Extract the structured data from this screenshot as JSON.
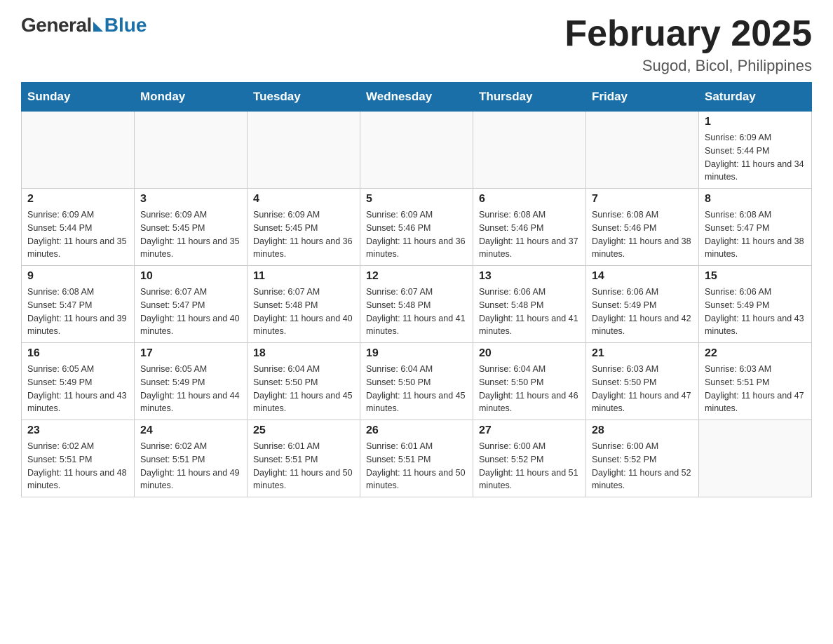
{
  "logo": {
    "general": "General",
    "blue": "Blue"
  },
  "header": {
    "month_year": "February 2025",
    "location": "Sugod, Bicol, Philippines"
  },
  "days_of_week": [
    "Sunday",
    "Monday",
    "Tuesday",
    "Wednesday",
    "Thursday",
    "Friday",
    "Saturday"
  ],
  "weeks": [
    [
      null,
      null,
      null,
      null,
      null,
      null,
      {
        "day": "1",
        "sunrise": "Sunrise: 6:09 AM",
        "sunset": "Sunset: 5:44 PM",
        "daylight": "Daylight: 11 hours and 34 minutes."
      }
    ],
    [
      {
        "day": "2",
        "sunrise": "Sunrise: 6:09 AM",
        "sunset": "Sunset: 5:44 PM",
        "daylight": "Daylight: 11 hours and 35 minutes."
      },
      {
        "day": "3",
        "sunrise": "Sunrise: 6:09 AM",
        "sunset": "Sunset: 5:45 PM",
        "daylight": "Daylight: 11 hours and 35 minutes."
      },
      {
        "day": "4",
        "sunrise": "Sunrise: 6:09 AM",
        "sunset": "Sunset: 5:45 PM",
        "daylight": "Daylight: 11 hours and 36 minutes."
      },
      {
        "day": "5",
        "sunrise": "Sunrise: 6:09 AM",
        "sunset": "Sunset: 5:46 PM",
        "daylight": "Daylight: 11 hours and 36 minutes."
      },
      {
        "day": "6",
        "sunrise": "Sunrise: 6:08 AM",
        "sunset": "Sunset: 5:46 PM",
        "daylight": "Daylight: 11 hours and 37 minutes."
      },
      {
        "day": "7",
        "sunrise": "Sunrise: 6:08 AM",
        "sunset": "Sunset: 5:46 PM",
        "daylight": "Daylight: 11 hours and 38 minutes."
      },
      {
        "day": "8",
        "sunrise": "Sunrise: 6:08 AM",
        "sunset": "Sunset: 5:47 PM",
        "daylight": "Daylight: 11 hours and 38 minutes."
      }
    ],
    [
      {
        "day": "9",
        "sunrise": "Sunrise: 6:08 AM",
        "sunset": "Sunset: 5:47 PM",
        "daylight": "Daylight: 11 hours and 39 minutes."
      },
      {
        "day": "10",
        "sunrise": "Sunrise: 6:07 AM",
        "sunset": "Sunset: 5:47 PM",
        "daylight": "Daylight: 11 hours and 40 minutes."
      },
      {
        "day": "11",
        "sunrise": "Sunrise: 6:07 AM",
        "sunset": "Sunset: 5:48 PM",
        "daylight": "Daylight: 11 hours and 40 minutes."
      },
      {
        "day": "12",
        "sunrise": "Sunrise: 6:07 AM",
        "sunset": "Sunset: 5:48 PM",
        "daylight": "Daylight: 11 hours and 41 minutes."
      },
      {
        "day": "13",
        "sunrise": "Sunrise: 6:06 AM",
        "sunset": "Sunset: 5:48 PM",
        "daylight": "Daylight: 11 hours and 41 minutes."
      },
      {
        "day": "14",
        "sunrise": "Sunrise: 6:06 AM",
        "sunset": "Sunset: 5:49 PM",
        "daylight": "Daylight: 11 hours and 42 minutes."
      },
      {
        "day": "15",
        "sunrise": "Sunrise: 6:06 AM",
        "sunset": "Sunset: 5:49 PM",
        "daylight": "Daylight: 11 hours and 43 minutes."
      }
    ],
    [
      {
        "day": "16",
        "sunrise": "Sunrise: 6:05 AM",
        "sunset": "Sunset: 5:49 PM",
        "daylight": "Daylight: 11 hours and 43 minutes."
      },
      {
        "day": "17",
        "sunrise": "Sunrise: 6:05 AM",
        "sunset": "Sunset: 5:49 PM",
        "daylight": "Daylight: 11 hours and 44 minutes."
      },
      {
        "day": "18",
        "sunrise": "Sunrise: 6:04 AM",
        "sunset": "Sunset: 5:50 PM",
        "daylight": "Daylight: 11 hours and 45 minutes."
      },
      {
        "day": "19",
        "sunrise": "Sunrise: 6:04 AM",
        "sunset": "Sunset: 5:50 PM",
        "daylight": "Daylight: 11 hours and 45 minutes."
      },
      {
        "day": "20",
        "sunrise": "Sunrise: 6:04 AM",
        "sunset": "Sunset: 5:50 PM",
        "daylight": "Daylight: 11 hours and 46 minutes."
      },
      {
        "day": "21",
        "sunrise": "Sunrise: 6:03 AM",
        "sunset": "Sunset: 5:50 PM",
        "daylight": "Daylight: 11 hours and 47 minutes."
      },
      {
        "day": "22",
        "sunrise": "Sunrise: 6:03 AM",
        "sunset": "Sunset: 5:51 PM",
        "daylight": "Daylight: 11 hours and 47 minutes."
      }
    ],
    [
      {
        "day": "23",
        "sunrise": "Sunrise: 6:02 AM",
        "sunset": "Sunset: 5:51 PM",
        "daylight": "Daylight: 11 hours and 48 minutes."
      },
      {
        "day": "24",
        "sunrise": "Sunrise: 6:02 AM",
        "sunset": "Sunset: 5:51 PM",
        "daylight": "Daylight: 11 hours and 49 minutes."
      },
      {
        "day": "25",
        "sunrise": "Sunrise: 6:01 AM",
        "sunset": "Sunset: 5:51 PM",
        "daylight": "Daylight: 11 hours and 50 minutes."
      },
      {
        "day": "26",
        "sunrise": "Sunrise: 6:01 AM",
        "sunset": "Sunset: 5:51 PM",
        "daylight": "Daylight: 11 hours and 50 minutes."
      },
      {
        "day": "27",
        "sunrise": "Sunrise: 6:00 AM",
        "sunset": "Sunset: 5:52 PM",
        "daylight": "Daylight: 11 hours and 51 minutes."
      },
      {
        "day": "28",
        "sunrise": "Sunrise: 6:00 AM",
        "sunset": "Sunset: 5:52 PM",
        "daylight": "Daylight: 11 hours and 52 minutes."
      },
      null
    ]
  ]
}
